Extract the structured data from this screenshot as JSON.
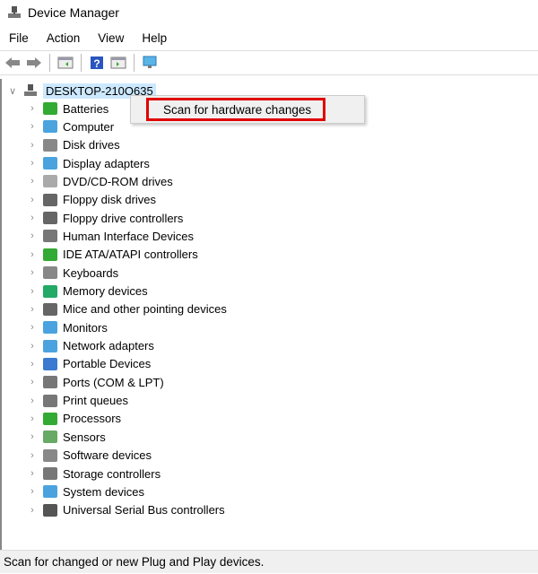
{
  "window": {
    "title": "Device Manager"
  },
  "menu": [
    "File",
    "Action",
    "View",
    "Help"
  ],
  "toolbar": [
    "back-icon",
    "forward-icon",
    "show-hide-console-tree-icon",
    "help-icon",
    "properties-pane-icon",
    "monitor-icon"
  ],
  "tree": {
    "root": "DESKTOP-210O635",
    "items": [
      "Batteries",
      "Computer",
      "Disk drives",
      "Display adapters",
      "DVD/CD-ROM drives",
      "Floppy disk drives",
      "Floppy drive controllers",
      "Human Interface Devices",
      "IDE ATA/ATAPI controllers",
      "Keyboards",
      "Memory devices",
      "Mice and other pointing devices",
      "Monitors",
      "Network adapters",
      "Portable Devices",
      "Ports (COM & LPT)",
      "Print queues",
      "Processors",
      "Sensors",
      "Software devices",
      "Storage controllers",
      "System devices",
      "Universal Serial Bus controllers"
    ]
  },
  "context_menu": {
    "item": "Scan for hardware changes",
    "highlight_color": "#e00000"
  },
  "status": "Scan for changed or new Plug and Play devices."
}
